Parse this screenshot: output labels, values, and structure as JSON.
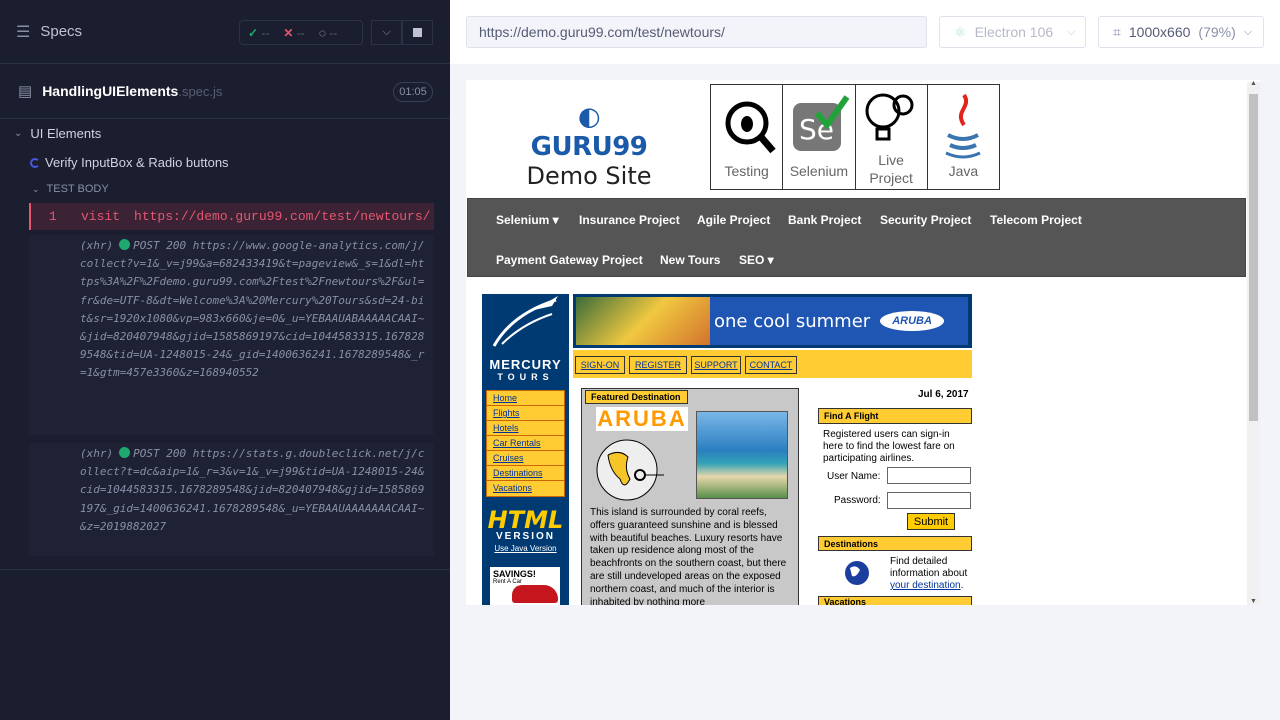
{
  "runner": {
    "specs_title": "Specs",
    "stats": {
      "passed": "--",
      "failed": "--",
      "pending": "--"
    },
    "spec_file": {
      "name": "HandlingUIElements",
      "ext": ".spec.js",
      "duration": "01:05"
    },
    "suite": "UI Elements",
    "test": "Verify InputBox & Radio buttons",
    "section": "TEST BODY",
    "command": {
      "number": "1",
      "keyword": "visit",
      "url": "https://demo.guru99.com/test/newtours/"
    },
    "logs": [
      {
        "prefix": "(xhr)",
        "method": "POST 200",
        "url": "https://www.google-analytics.com/j/collect?v=1&_v=j99&a=682433419&t=pageview&_s=1&dl=https%3A%2F%2Fdemo.guru99.com%2Ftest%2Fnewtours%2F&ul=fr&de=UTF-8&dt=Welcome%3A%20Mercury%20Tours&sd=24-bit&sr=1920x1080&vp=983x660&je=0&_u=YEBAAUABAAAAACAAI~&jid=820407948&gjid=1585869197&cid=1044583315.1678289548&tid=UA-1248015-24&_gid=1400636241.1678289548&_r=1&gtm=457e3360&z=168940552"
      },
      {
        "prefix": "(xhr)",
        "method": "POST 200",
        "url": "https://stats.g.doubleclick.net/j/collect?t=dc&aip=1&_r=3&v=1&_v=j99&tid=UA-1248015-24&cid=1044583315.1678289548&jid=820407948&gjid=1585869197&_gid=1400636241.1678289548&_u=YEBAAUAAAAAAACAAI~&z=2019882027"
      }
    ]
  },
  "aut": {
    "url": "https://demo.guru99.com/test/newtours/",
    "browser": "Electron 106",
    "viewport": "1000x660",
    "zoom": "(79%)"
  },
  "site": {
    "logo_line1": "GURU99",
    "logo_line2": "Demo Site",
    "tiles": [
      "Testing",
      "Selenium",
      "Live Project",
      "Java"
    ],
    "nav_row1": [
      "Selenium ▾",
      "Insurance Project",
      "Agile Project",
      "Bank Project",
      "Security Project",
      "Telecom Project"
    ],
    "nav_row2": [
      "Payment Gateway Project",
      "New Tours",
      "SEO ▾"
    ],
    "mercury": {
      "brand1": "MERCURY",
      "brand2": "TOURS",
      "banner": "one cool summer",
      "banner_logo": "ARUBA",
      "tabs": [
        "SIGN-ON",
        "REGISTER",
        "SUPPORT",
        "CONTACT"
      ],
      "menu": [
        "Home",
        "Flights",
        "Hotels",
        "Car Rentals",
        "Cruises",
        "Destinations",
        "Vacations"
      ],
      "html_line1": "HTML",
      "html_line2": "VERSION",
      "java_link": "Use Java Version",
      "ad_title": "SAVINGS!",
      "ad_sub": "Rent A Car",
      "featured_title": "Featured Destination",
      "featured_name": "ARUBA",
      "featured_text": "This island is surrounded by coral reefs, offers guaranteed sunshine and is blessed with beautiful beaches. Luxury resorts have taken up residence along most of the beachfronts on the southern coast, but there are still undeveloped areas on the exposed northern coast, and much of the interior is inhabited by nothing more",
      "date": "Jul 6, 2017",
      "find_flight": "Find A Flight",
      "flight_text": "Registered users can sign-in here to find the lowest fare on participating airlines.",
      "user_label": "User Name:",
      "pass_label": "Password:",
      "submit": "Submit",
      "destinations_title": "Destinations",
      "dest_text": "Find detailed information about",
      "dest_link": "your destination",
      "vacations_title": "Vacations"
    }
  }
}
